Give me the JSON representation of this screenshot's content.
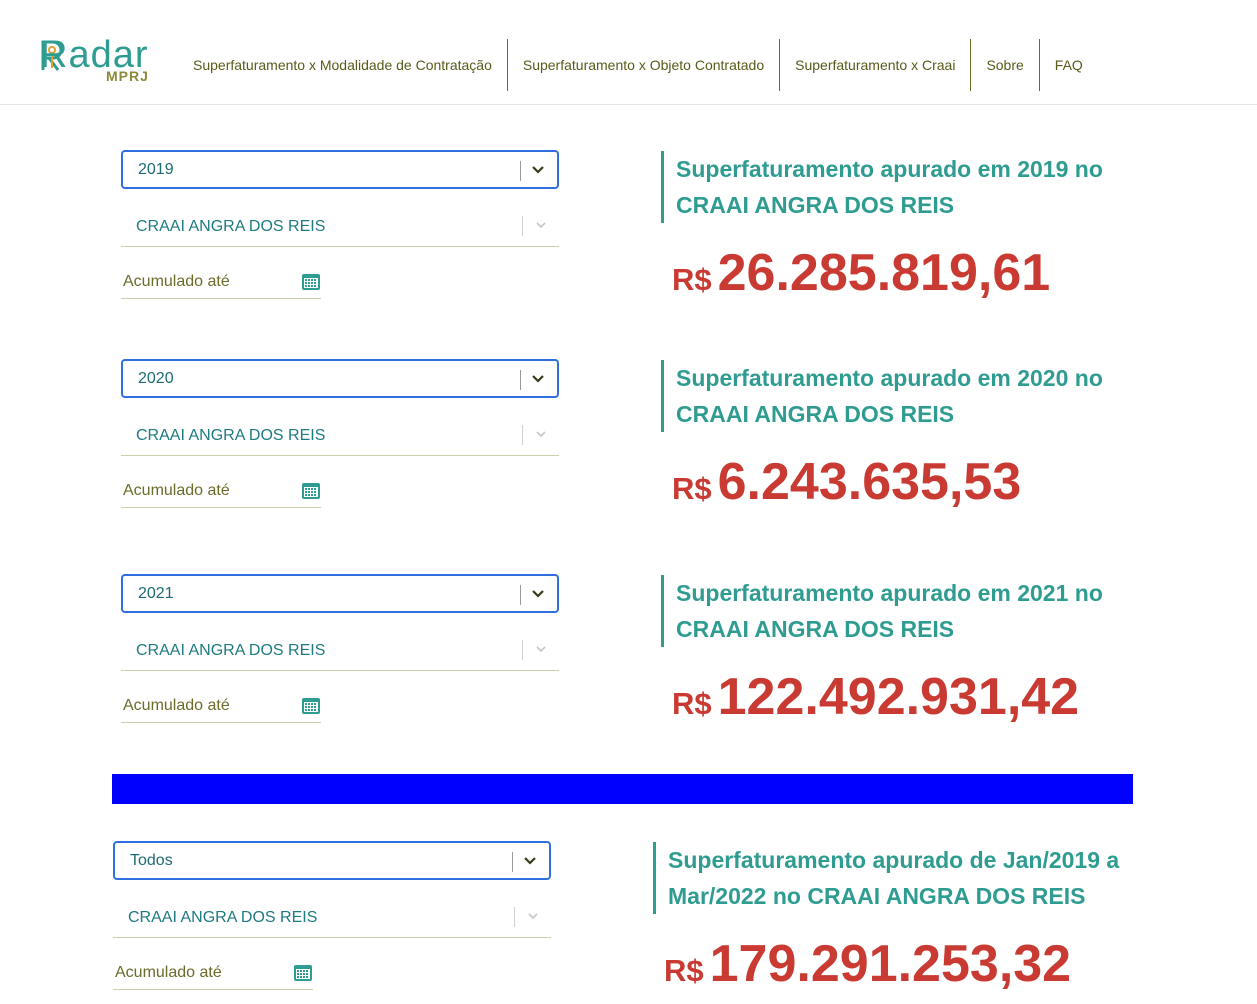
{
  "header": {
    "logo_word": "Radar",
    "logo_sub": "MPRJ",
    "nav": [
      "Superfaturamento x Modalidade de Contratação",
      "Superfaturamento x Objeto Contratado",
      "Superfaturamento x Craai",
      "Sobre",
      "FAQ"
    ]
  },
  "blocks": [
    {
      "year": "2019",
      "craai": "CRAAI ANGRA DOS REIS",
      "date_label": "Acumulado até",
      "title": "Superfaturamento apurado em 2019 no CRAAI ANGRA DOS REIS",
      "currency": "R$",
      "amount": "26.285.819,61"
    },
    {
      "year": "2020",
      "craai": "CRAAI ANGRA DOS REIS",
      "date_label": "Acumulado até",
      "title": "Superfaturamento apurado em 2020 no CRAAI ANGRA DOS REIS",
      "currency": "R$",
      "amount": "6.243.635,53"
    },
    {
      "year": "2021",
      "craai": "CRAAI ANGRA DOS REIS",
      "date_label": "Acumulado até",
      "title": "Superfaturamento apurado em 2021 no CRAAI ANGRA DOS REIS",
      "currency": "R$",
      "amount": "122.492.931,42"
    },
    {
      "year": "Todos",
      "craai": "CRAAI ANGRA DOS REIS",
      "date_label": "Acumulado até",
      "title": "Superfaturamento apurado de Jan/2019 a Mar/2022 no CRAAI ANGRA DOS REIS",
      "currency": "R$",
      "amount": "179.291.253,32"
    }
  ],
  "icons": {
    "chevron": "chevron-down-icon",
    "calendar": "calendar-icon"
  },
  "colors": {
    "accent_teal": "#2f9c92",
    "value_red": "#c83a32",
    "select_border": "#2f6fe0",
    "nav_text": "#5a5a1a",
    "separator_blue": "#0000ff"
  }
}
